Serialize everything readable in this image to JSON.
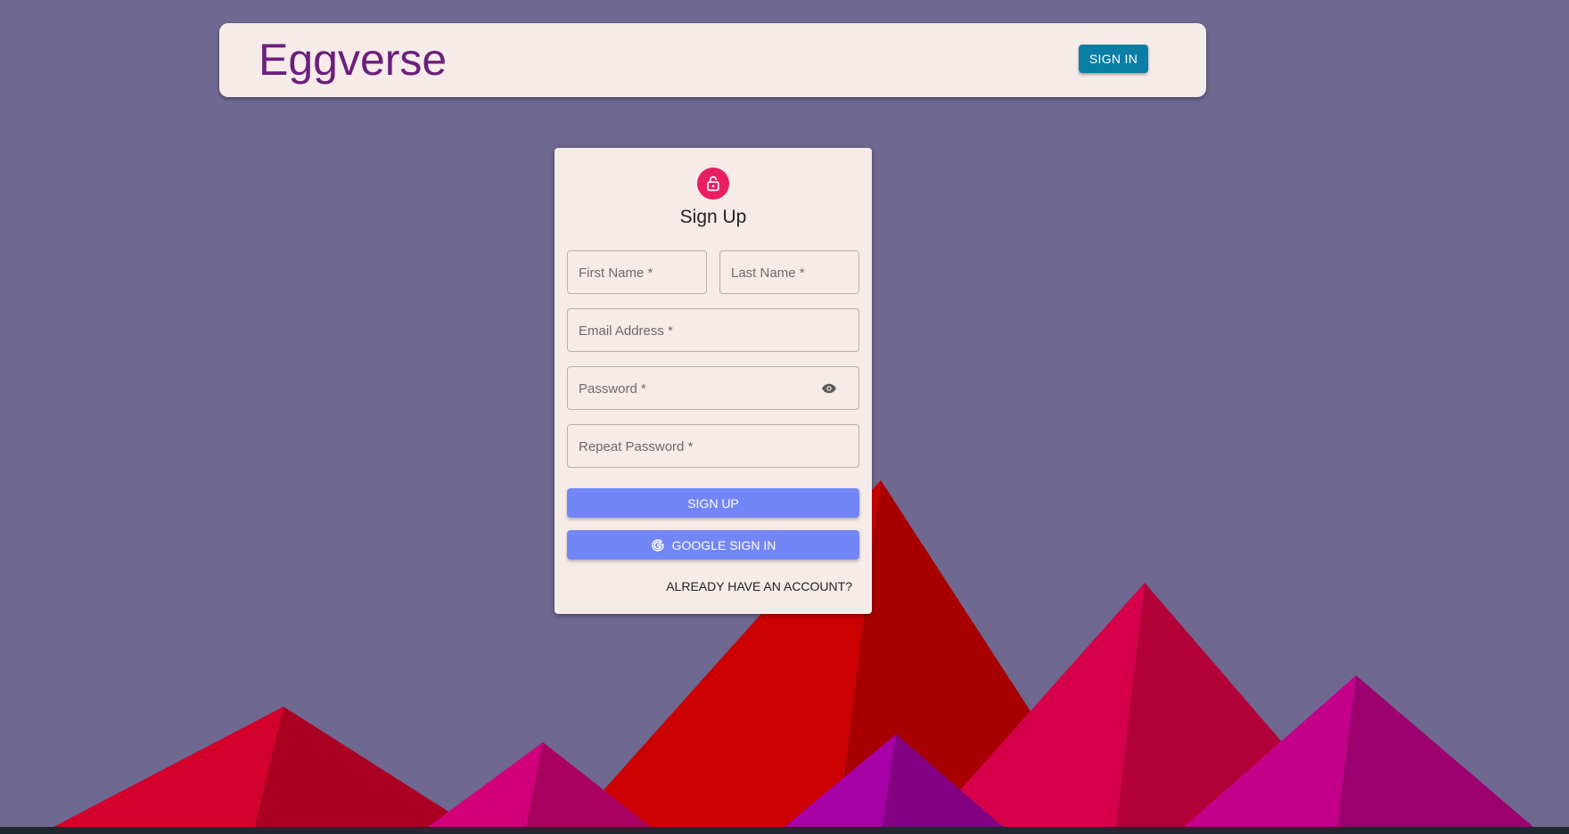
{
  "header": {
    "brand": "Eggverse",
    "signin_label": "SIGN IN"
  },
  "signup": {
    "title": "Sign Up",
    "lock_icon": "lock-open-icon",
    "fields": {
      "first_name": "First Name *",
      "last_name": "Last Name *",
      "email": "Email Address *",
      "password": "Password *",
      "repeat_password": "Repeat Password *"
    },
    "password_toggle_icon": "eye-icon",
    "signup_label": "SIGN UP",
    "google_label": "GOOGLE SIGN IN",
    "google_icon": "google-icon",
    "account_link": "ALREADY HAVE AN ACCOUNT?"
  },
  "colors": {
    "background": "#6f6891",
    "header_bg": "#f6ebe8",
    "brand_text": "#6b1f7c",
    "signin_button": "#0a7ea4",
    "avatar": "#e91e63",
    "primary_button": "#7386f7"
  }
}
